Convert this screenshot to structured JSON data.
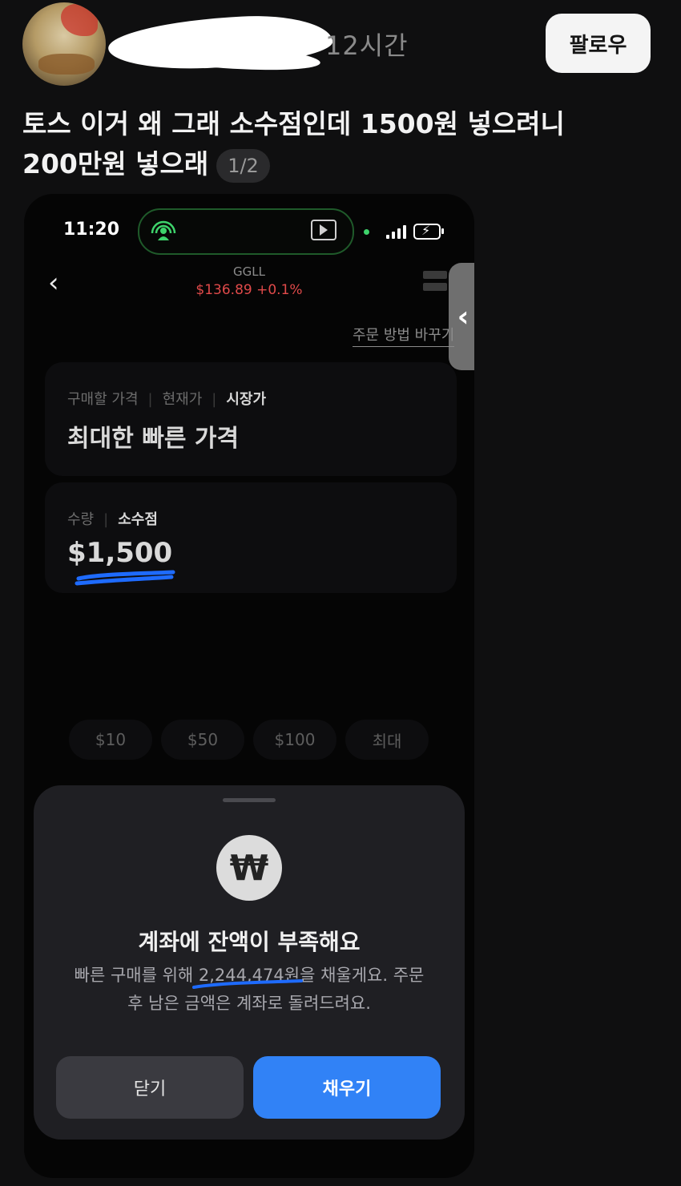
{
  "post": {
    "time_ago": "12시간",
    "follow_label": "팔로우",
    "text_line1": "토스 이거 왜 그래 소수점인데 1500원 넣으려니",
    "text_line2": "200만원 넣으래",
    "image_pager": "1/2"
  },
  "phone": {
    "status_time": "11:20",
    "ticker": "GGLL",
    "price": "$136.89 +0.1%",
    "change_order_link": "주문 방법 바꾸기",
    "price_card": {
      "tabs": [
        "구매할 가격",
        "현재가",
        "시장가"
      ],
      "value": "최대한 빠른 가격"
    },
    "qty_card": {
      "tabs": [
        "수량",
        "소수점"
      ],
      "value": "$1,500"
    },
    "quick_chips": [
      "$10",
      "$50",
      "$100",
      "최대"
    ],
    "sheet": {
      "title": "계좌에 잔액이 부족해요",
      "desc_line1": "빠른 구매를 위해 2,244,474원을 채울게요. 주문",
      "desc_line2": "후 남은 금액은 계좌로 돌려드려요.",
      "close_label": "닫기",
      "fill_label": "채우기",
      "icon_glyph": "₩"
    },
    "icons": {
      "back": "chevron-left-icon",
      "side_handle": "chevron-left-icon",
      "menu": "menu-icon",
      "currency": "won-icon"
    }
  },
  "colors": {
    "accent_blue": "#3182f6",
    "price_red": "#e04a4a",
    "island_green": "#1f5a2a"
  }
}
